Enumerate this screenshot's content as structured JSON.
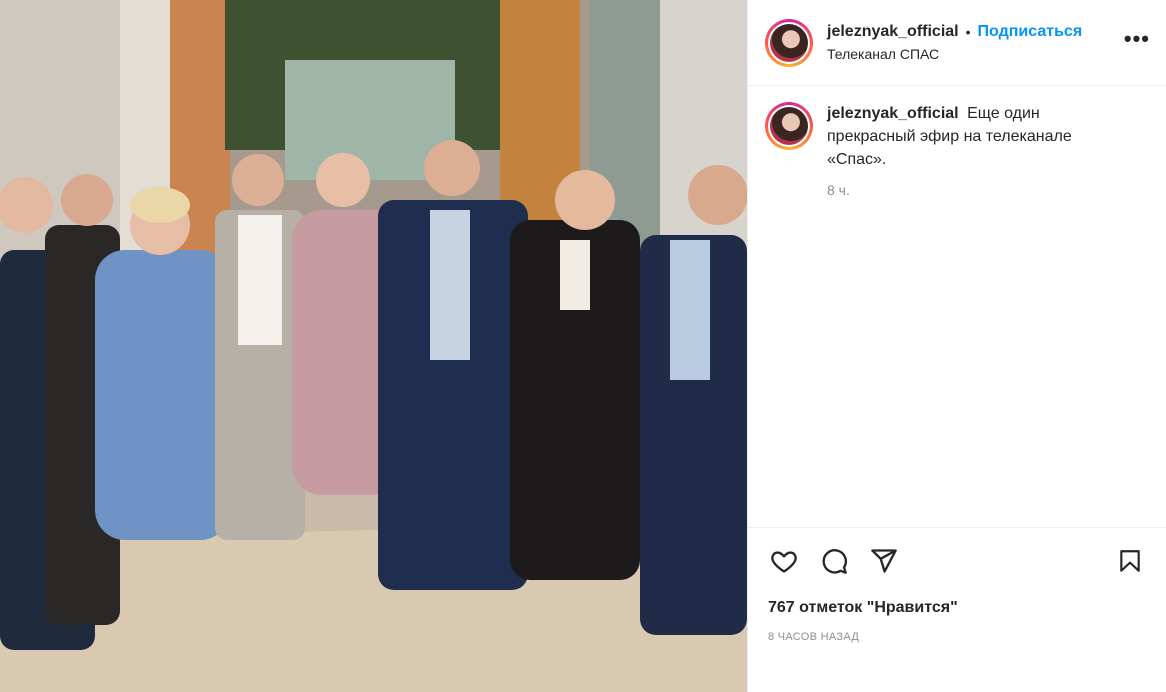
{
  "post": {
    "username": "jeleznyak_official",
    "follow_label": "Подписаться",
    "separator": "•",
    "location": "Телеканал СПАС",
    "more_label": "•••",
    "caption_text": "Еще один прекрасный эфир на телеканале «Спас».",
    "caption_age": "8 ч.",
    "likes_text": "767 отметок \"Нравится\"",
    "timestamp": "8 ЧАСОВ НАЗАД"
  },
  "icons": {
    "like": "heart-icon",
    "comment": "comment-icon",
    "share": "paper-plane-icon",
    "save": "bookmark-icon",
    "more": "more-options-icon"
  },
  "colors": {
    "accent": "#0095f6",
    "text": "#262626",
    "secondary": "#8e8e8e",
    "divider": "#efefef"
  }
}
